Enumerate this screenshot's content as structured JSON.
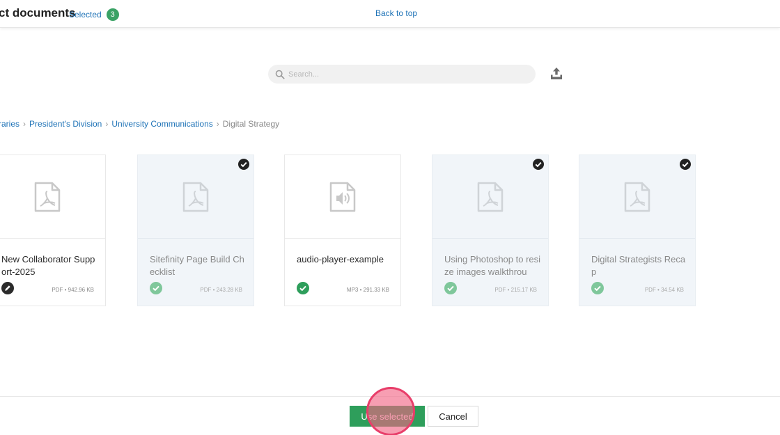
{
  "header": {
    "title": "ct documents",
    "selected_label": "Selected",
    "selected_count": "3",
    "back_to_top": "Back to top"
  },
  "search": {
    "placeholder": "Search...",
    "value": ""
  },
  "breadcrumb": [
    {
      "label": "raries",
      "current": false
    },
    {
      "label": "President's Division",
      "current": false
    },
    {
      "label": "University Communications",
      "current": false
    },
    {
      "label": "Digital Strategy",
      "current": true
    }
  ],
  "documents": [
    {
      "name": "New Collaborator Support-2025",
      "type": "PDF",
      "size": "942.96 KB",
      "selected": false,
      "status_icon": "pencil-icon",
      "file_icon": "pdf-icon"
    },
    {
      "name": "Sitefinity Page Build Checklist",
      "type": "PDF",
      "size": "243.28 KB",
      "selected": true,
      "status_icon": "published-check-icon",
      "file_icon": "pdf-icon"
    },
    {
      "name": "audio-player-example",
      "type": "MP3",
      "size": "291.33 KB",
      "selected": false,
      "status_icon": "published-check-icon",
      "file_icon": "audio-file-icon"
    },
    {
      "name": "Using Photoshop to resize images walkthrou",
      "type": "PDF",
      "size": "215.17 KB",
      "selected": true,
      "status_icon": "published-check-icon",
      "file_icon": "pdf-icon"
    },
    {
      "name": "Digital Strategists Recap",
      "type": "PDF",
      "size": "34.54 KB",
      "selected": true,
      "status_icon": "published-check-icon",
      "file_icon": "pdf-icon"
    }
  ],
  "footer": {
    "use_selected": "Use selected",
    "cancel": "Cancel"
  },
  "colors": {
    "accent": "#1f73b7",
    "success": "#2e9e5b",
    "badge": "#3aa265",
    "selected_card_bg": "#f1f5f9"
  }
}
